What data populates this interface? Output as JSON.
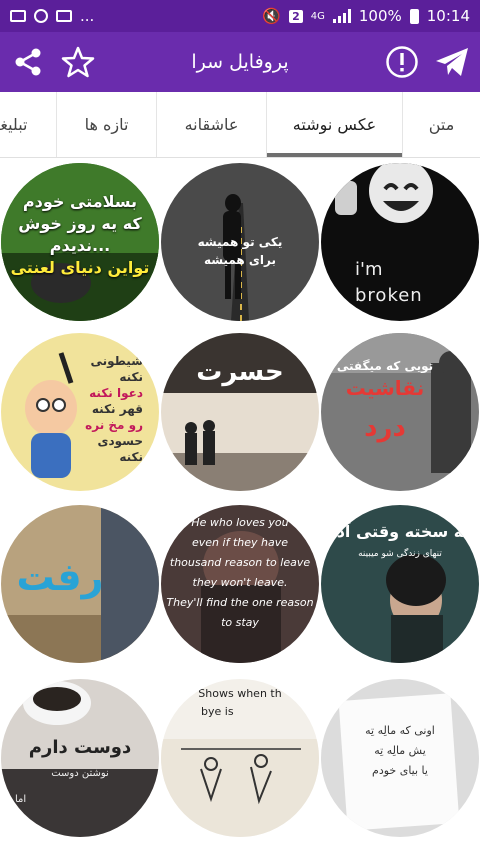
{
  "status_bar": {
    "left_glyph": "...",
    "sim": "2",
    "network": "4G",
    "battery_text": "100%",
    "time": "10:14"
  },
  "app_bar": {
    "title": "پروفایل سرا",
    "icons": [
      "share-icon",
      "star-icon",
      "info-icon",
      "telegram-icon"
    ]
  },
  "tabs": [
    {
      "label": "متن",
      "active": false
    },
    {
      "label": "عکس نوشته",
      "active": true
    },
    {
      "label": "عاشقانه",
      "active": false
    },
    {
      "label": "تازه ها",
      "active": false
    },
    {
      "label": "تبلیغا",
      "active": false
    }
  ],
  "grid": {
    "items": [
      {
        "lines": [
          "بسلامتی خودم",
          "که یه روز خوش",
          "ندیدم...",
          "تواین دنیای لعنتی"
        ],
        "bg": "#2f6b1f"
      },
      {
        "lines": [
          "یکی تو همیشه",
          "برای همیشه"
        ],
        "bg": "#3a3a3a"
      },
      {
        "lines": [
          "i'm",
          "broken"
        ],
        "bg": "#101010"
      },
      {
        "lines": [
          "شیطونی نکنه",
          "دعوا نکنه",
          "قهر نکنه",
          "رو مخ نره",
          "حسودی نکنه"
        ],
        "bg": "#e8d48a"
      },
      {
        "lines": [
          "حسرت"
        ],
        "bg": "#d9d0c4"
      },
      {
        "lines": [
          "تویی که میگفتی",
          "نقاشیت",
          "درد"
        ],
        "bg": "#6e6e6e"
      },
      {
        "lines": [
          "رفت"
        ],
        "bg": "#b8a27e"
      },
      {
        "lines": [
          "He who loves you",
          "even if they have",
          "thousand reason to leave",
          "they won't leave.",
          "They'll find the one reason",
          "to stay"
        ],
        "bg": "#4a3a38"
      },
      {
        "lines": [
          "چه سخته وقتی آدم",
          "تنهای زندگی شو میبینه"
        ],
        "bg": "#2e4a4a"
      },
      {
        "lines": [
          "دوست دارم",
          "نوشتن دوست",
          "اما"
        ],
        "bg": "#d8d3ce"
      },
      {
        "lines": [
          "Shows when th",
          "bye is"
        ],
        "bg": "#f3f0ea"
      },
      {
        "lines": [
          "اونی که مالِه تِه",
          "یش مالِه تِه",
          "یا بیای خودم"
        ],
        "bg": "#f7f7f7"
      }
    ]
  }
}
